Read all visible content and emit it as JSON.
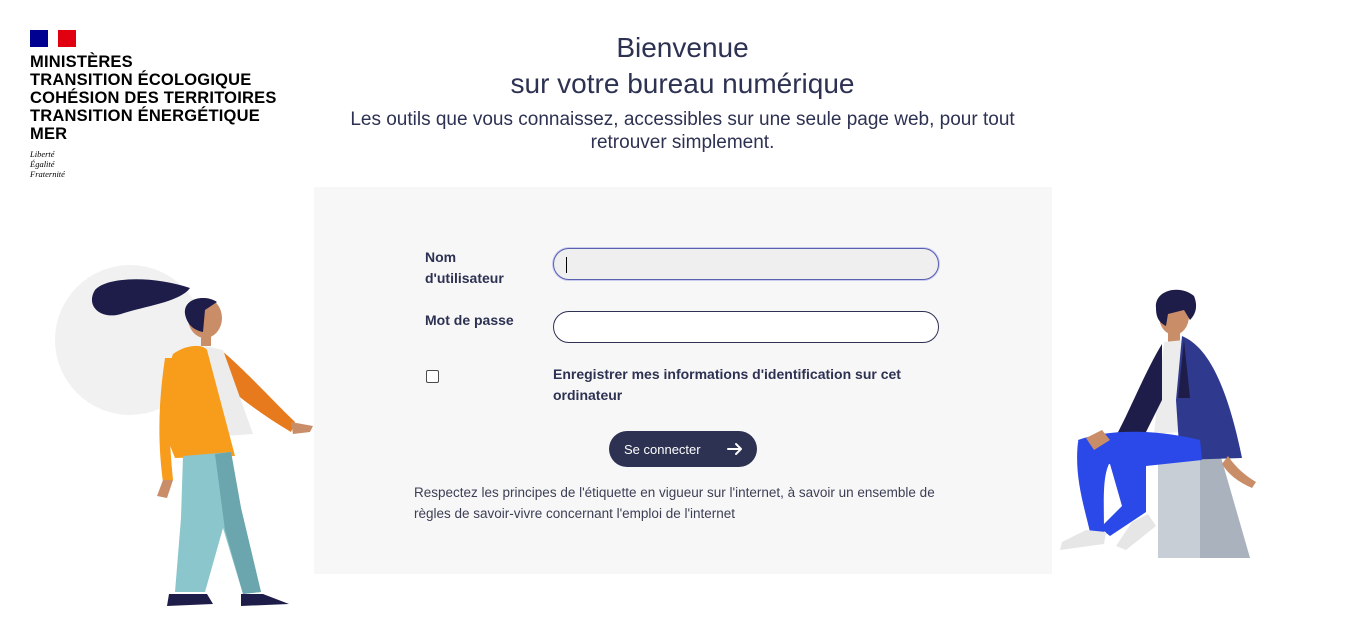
{
  "logo": {
    "ministry_lines": [
      "MINISTÈRES",
      "TRANSITION ÉCOLOGIQUE",
      "COHÉSION DES TERRITOIRES",
      "TRANSITION ÉNERGÉTIQUE",
      "MER"
    ],
    "motto": [
      "Liberté",
      "Égalité",
      "Fraternité"
    ],
    "colors": {
      "blue": "#000091",
      "red": "#e1000f"
    }
  },
  "header": {
    "title_line1": "Bienvenue",
    "title_line2": "sur votre bureau numérique",
    "subtitle": "Les outils que vous connaissez, accessibles sur une seule page web, pour tout retrouver simplement."
  },
  "login_form": {
    "username_label_line1": "Nom",
    "username_label_line2": "d'utilisateur",
    "username_value": "",
    "password_label": "Mot de passe",
    "password_value": "",
    "remember_label": "Enregistrer mes informations d'identification sur cet ordinateur",
    "remember_checked": false,
    "submit_label": "Se connecter",
    "submit_icon": "arrow-right-icon",
    "etiquette_text": "Respectez les principes de l'étiquette en vigueur sur l'internet, à savoir un ensemble de règles de savoir-vivre concernant l'emploi de l'internet"
  },
  "theme": {
    "primary": "#2d3152",
    "card_background": "#f7f7f7"
  }
}
